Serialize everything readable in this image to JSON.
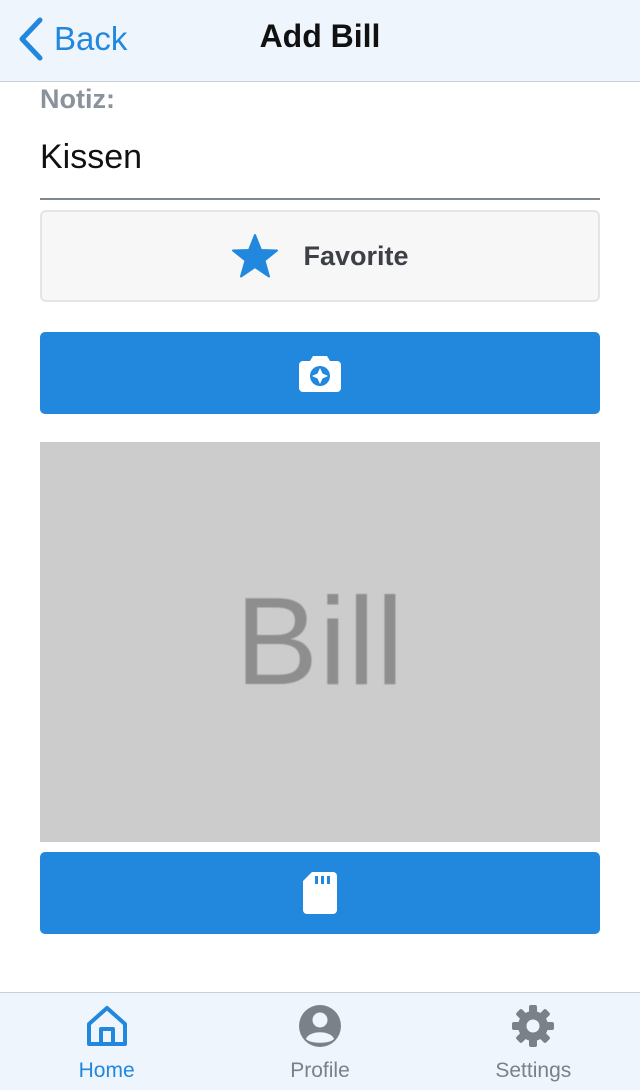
{
  "navbar": {
    "back_label": "Back",
    "title": "Add Bill",
    "back_icon": "chevron-left-icon"
  },
  "form": {
    "note_label": "Notiz:",
    "note_value": "Kissen",
    "favorite_label": "Favorite",
    "favorite_icon": "star-icon",
    "camera_icon": "camera-icon",
    "sd_icon": "sd-card-icon"
  },
  "bill_image": {
    "text": "Bill"
  },
  "tabbar": {
    "tabs": [
      {
        "label": "Home",
        "icon": "home-icon",
        "active": true
      },
      {
        "label": "Profile",
        "icon": "profile-icon",
        "active": false
      },
      {
        "label": "Settings",
        "icon": "settings-icon",
        "active": false
      }
    ]
  },
  "colors": {
    "accent": "#2188dd",
    "bar_background": "#eef5fd",
    "placeholder_gray": "#cccccc",
    "inactive_tab": "#7b8189"
  }
}
